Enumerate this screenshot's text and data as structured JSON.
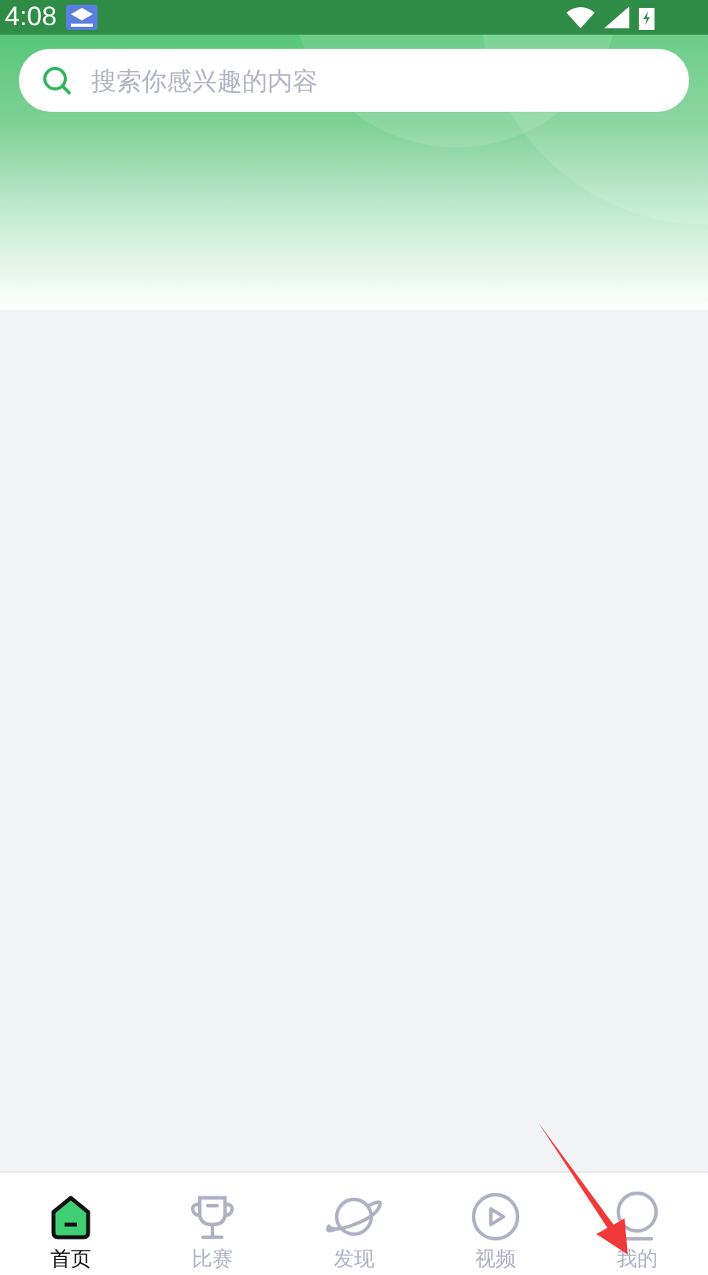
{
  "status_bar": {
    "time": "4:08"
  },
  "search": {
    "placeholder": "搜索你感兴趣的内容"
  },
  "tabs": [
    {
      "label": "首页",
      "kind": "home",
      "selected": true
    },
    {
      "label": "比赛",
      "kind": "trophy",
      "selected": false
    },
    {
      "label": "发现",
      "kind": "planet",
      "selected": false
    },
    {
      "label": "视频",
      "kind": "play",
      "selected": false
    },
    {
      "label": "我的",
      "kind": "person",
      "selected": false
    }
  ]
}
